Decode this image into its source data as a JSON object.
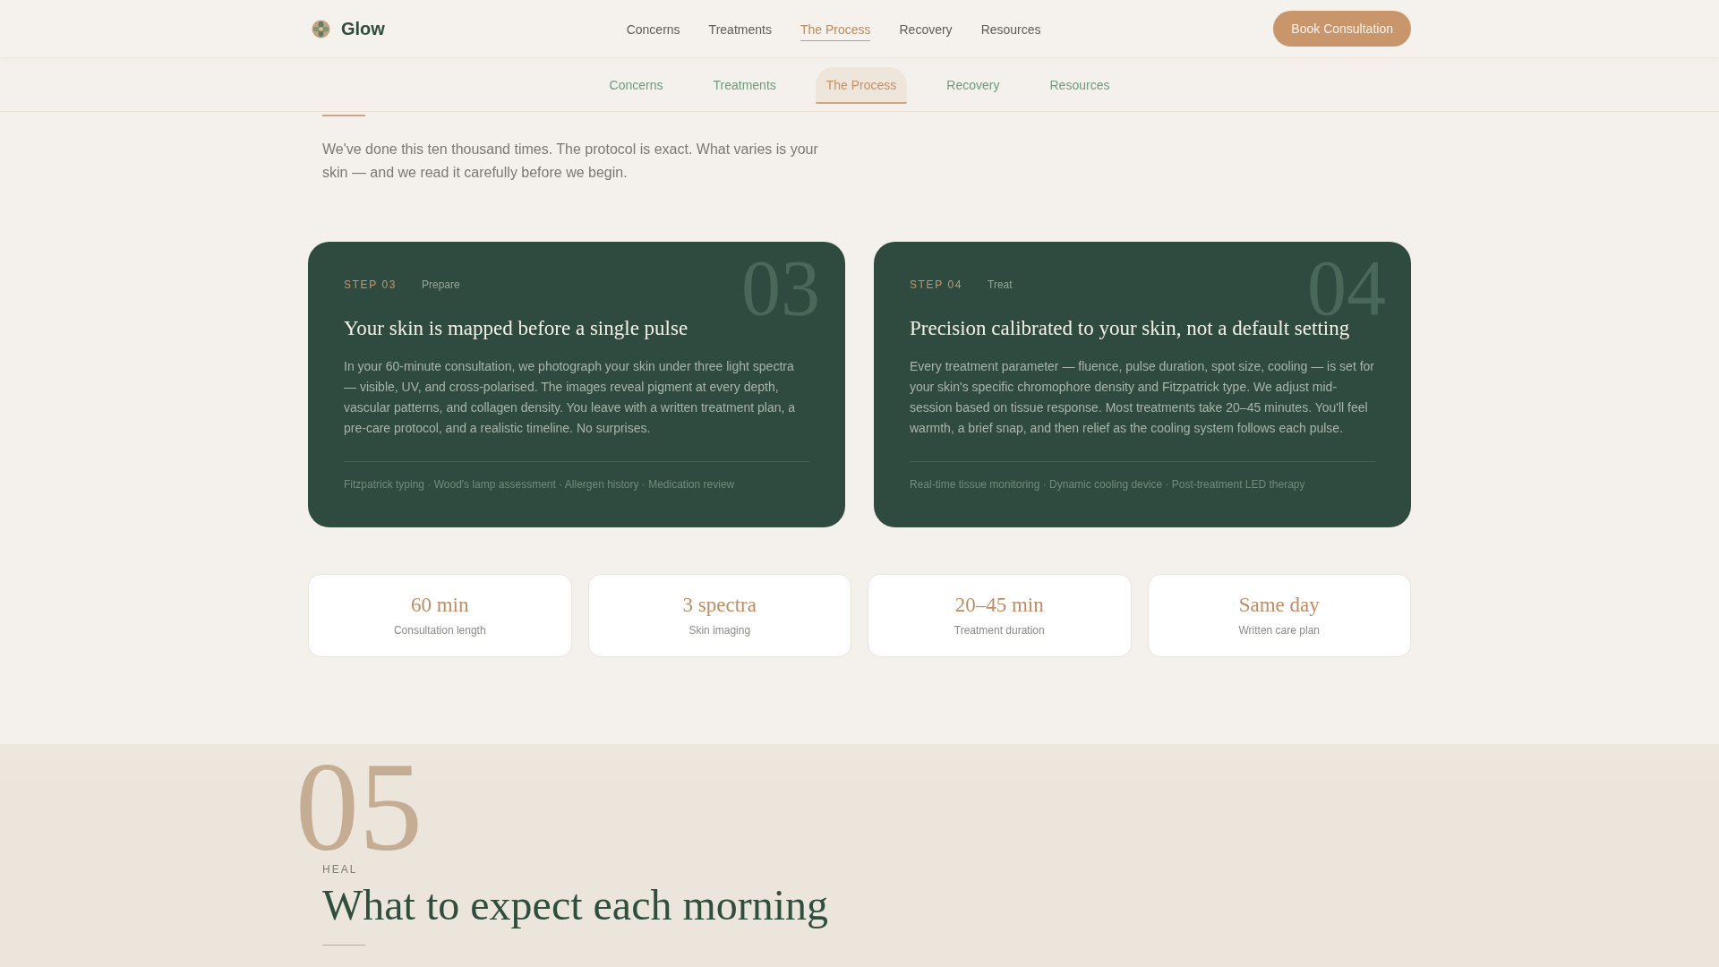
{
  "header": {
    "brand": "Glow",
    "nav": [
      {
        "label": "Concerns",
        "selected": false
      },
      {
        "label": "Treatments",
        "selected": false
      },
      {
        "label": "The Process",
        "selected": true
      },
      {
        "label": "Recovery",
        "selected": false
      },
      {
        "label": "Resources",
        "selected": false
      }
    ],
    "cta": "Book Consultation"
  },
  "subnav": [
    {
      "label": "Concerns",
      "selected": false
    },
    {
      "label": "Treatments",
      "selected": false
    },
    {
      "label": "The Process",
      "selected": true
    },
    {
      "label": "Recovery",
      "selected": false
    },
    {
      "label": "Resources",
      "selected": false
    }
  ],
  "intro": "We've done this ten thousand times. The protocol is exact. What varies is your skin — and we read it carefully before we begin.",
  "steps": [
    {
      "step": "STEP 03",
      "phase": "Prepare",
      "numeral": "03",
      "title": "Your skin is mapped before a single pulse",
      "body": "In your 60-minute consultation, we photograph your skin under three light spectra — visible, UV, and cross-polarised. The images reveal pigment at every depth, vascular patterns, and collagen density. You leave with a written treatment plan, a pre-care protocol, and a realistic timeline. No surprises.",
      "tags": "Fitzpatrick typing · Wood's lamp assessment · Allergen history · Medication review"
    },
    {
      "step": "STEP 04",
      "phase": "Treat",
      "numeral": "04",
      "title": "Precision calibrated to your skin, not a default setting",
      "body": "Every treatment parameter — fluence, pulse duration, spot size, cooling — is set for your skin's specific chromophore density and Fitzpatrick type. We adjust mid-session based on tissue response. Most treatments take 20–45 minutes. You'll feel warmth, a brief snap, and then relief as the cooling system follows each pulse.",
      "tags": "Real-time tissue monitoring · Dynamic cooling device · Post-treatment LED therapy"
    }
  ],
  "stats": [
    {
      "value": "60 min",
      "label": "Consultation length"
    },
    {
      "value": "3 spectra",
      "label": "Skin imaging"
    },
    {
      "value": "20–45 min",
      "label": "Treatment duration"
    },
    {
      "value": "Same day",
      "label": "Written care plan"
    }
  ],
  "next_section": {
    "numeral": "05",
    "eyebrow": "HEAL",
    "heading": "What to expect each morning"
  }
}
